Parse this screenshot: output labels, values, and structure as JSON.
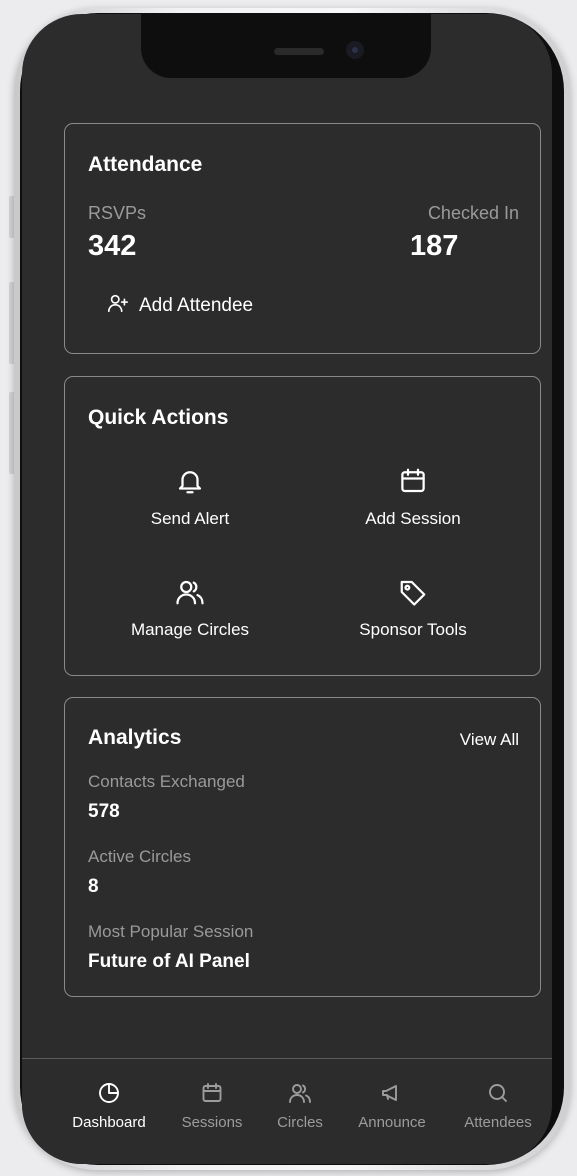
{
  "attendance": {
    "title": "Attendance",
    "rsvps_label": "RSVPs",
    "rsvps_value": "342",
    "checked_in_label": "Checked In",
    "checked_in_value": "187",
    "add_attendee_label": "Add Attendee",
    "add_attendee_icon": "user-plus-icon"
  },
  "quick_actions": {
    "title": "Quick Actions",
    "items": [
      {
        "label": "Send Alert",
        "icon": "bell-icon"
      },
      {
        "label": "Add Session",
        "icon": "calendar-icon"
      },
      {
        "label": "Manage Circles",
        "icon": "users-icon"
      },
      {
        "label": "Sponsor Tools",
        "icon": "tag-icon"
      }
    ]
  },
  "analytics": {
    "title": "Analytics",
    "view_all_label": "View All",
    "stats": [
      {
        "label": "Contacts Exchanged",
        "value": "578"
      },
      {
        "label": "Active Circles",
        "value": "8"
      },
      {
        "label": "Most Popular Session",
        "value": "Future of AI Panel"
      }
    ]
  },
  "tabs": [
    {
      "label": "Dashboard",
      "icon": "pie-chart-icon",
      "active": true
    },
    {
      "label": "Sessions",
      "icon": "calendar-icon",
      "active": false
    },
    {
      "label": "Circles",
      "icon": "users-icon",
      "active": false
    },
    {
      "label": "Announce",
      "icon": "megaphone-icon",
      "active": false
    },
    {
      "label": "Attendees",
      "icon": "search-icon",
      "active": false
    }
  ],
  "colors": {
    "screen_bg": "#2c2c2c",
    "card_border": "#8a8a8a",
    "text_primary": "#ffffff",
    "text_secondary": "#9a9a9a",
    "tab_inactive": "#9c9c9c"
  }
}
